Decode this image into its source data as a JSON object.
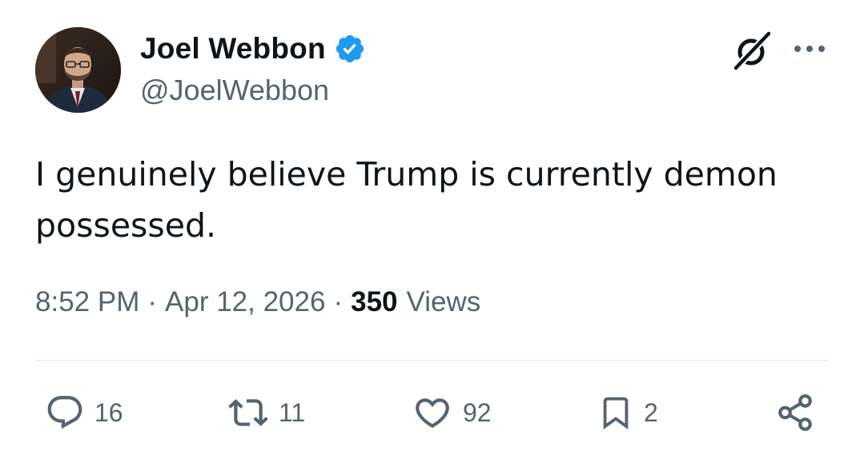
{
  "author": {
    "display_name": "Joel Webbon",
    "handle": "@JoelWebbon",
    "verified": true,
    "verified_color": "#1d9bf0"
  },
  "tweet": {
    "text": "I genuinely believe Trump is currently demon possessed."
  },
  "meta": {
    "time": "8:52 PM",
    "separator": "·",
    "date": "Apr 12, 2026",
    "views_count": "350",
    "views_label": "Views"
  },
  "header_actions": {
    "grok_icon": "grok-icon",
    "more_icon": "more-horizontal-icon"
  },
  "actions": {
    "replies": "16",
    "reposts": "11",
    "likes": "92",
    "bookmarks": "2"
  },
  "colors": {
    "text_primary": "#0f1419",
    "text_secondary": "#536471",
    "divider": "#e6e9eb"
  }
}
